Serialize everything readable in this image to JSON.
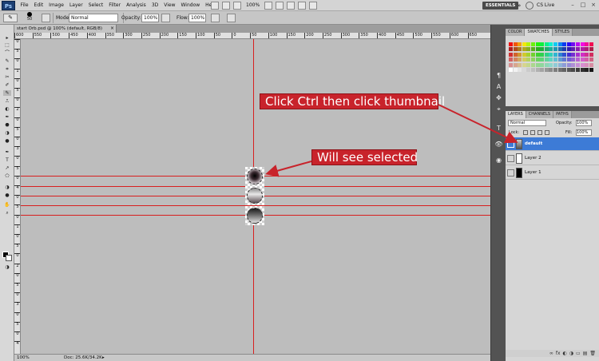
{
  "app": {
    "logo": "Ps"
  },
  "menubar": {
    "items": [
      "File",
      "Edit",
      "Image",
      "Layer",
      "Select",
      "Filter",
      "Analysis",
      "3D",
      "View",
      "Window",
      "Help"
    ],
    "zoom": "100%",
    "workspace": "ESSENTIALS",
    "cs_live": "CS Live",
    "chevron": "»",
    "minimize": "–",
    "restore": "□",
    "close": "×"
  },
  "options": {
    "brush_size": "50",
    "mode_label": "Mode:",
    "mode_value": "Normal",
    "opacity_label": "Opacity:",
    "opacity_value": "100%",
    "flow_label": "Flow:",
    "flow_value": "100%"
  },
  "document": {
    "tab_title": "start Orb.psd @ 100% (default, RGB/8)",
    "tab_close": "×"
  },
  "ruler_top": [
    "600",
    "550",
    "500",
    "450",
    "400",
    "350",
    "300",
    "250",
    "200",
    "150",
    "100",
    "50",
    "0",
    "50",
    "100",
    "150",
    "200",
    "250",
    "300",
    "350",
    "400",
    "450",
    "500",
    "550",
    "600",
    "650"
  ],
  "ruler_left": [
    "0",
    "5",
    "0",
    "1",
    "0",
    "5",
    "0",
    "2",
    "0",
    "5",
    "0",
    "3",
    "0",
    "5",
    "0",
    "4",
    "0",
    "5",
    "0",
    "1",
    "0",
    "5",
    "0",
    "2",
    "0",
    "5",
    "0",
    "3",
    "0",
    "5",
    "0",
    "4"
  ],
  "toolbox": {
    "glyphs": [
      "▸",
      "⬚",
      "⌒",
      "✎",
      "⌗",
      "✂",
      "✐",
      "✎",
      "⎍",
      "◐",
      "✒",
      "⬣",
      "T",
      "↗",
      "⬠",
      "✋",
      "⌕",
      "◑",
      "●"
    ]
  },
  "callouts": {
    "click_ctrl": "Click Ctrl then click thumbnail",
    "will_see": "Will see selected"
  },
  "status": {
    "zoom": "100%",
    "doc": "Doc: 25.6K/34.2K",
    "arrow": "▸"
  },
  "swatches_panel": {
    "tabs": [
      "COLOR",
      "SWATCHES",
      "STYLES"
    ],
    "active": "SWATCHES"
  },
  "layers_panel": {
    "tabs": [
      "LAYERS",
      "CHANNELS",
      "PATHS"
    ],
    "active": "LAYERS",
    "blend_mode": "Normal",
    "opacity_label": "Opacity:",
    "opacity_value": "100%",
    "lock_label": "Lock:",
    "fill_label": "Fill:",
    "fill_value": "100%",
    "layers": [
      {
        "name": "default",
        "selected": true
      },
      {
        "name": "Layer 2",
        "selected": false
      },
      {
        "name": "Layer 1",
        "selected": false
      }
    ],
    "footer_icons": [
      "∞",
      "fx",
      "◐",
      "◑",
      "▭",
      "▤",
      "🗑"
    ]
  },
  "dock": {
    "icons": [
      "¶",
      "A",
      "✥",
      "⌖",
      "T",
      "👁",
      "◉"
    ]
  },
  "colors": {
    "accent_red": "#c8232b",
    "guide_red": "#d81f1f",
    "selection_blue": "#3d7bd6",
    "canvas_gray": "#bdbdbd"
  }
}
